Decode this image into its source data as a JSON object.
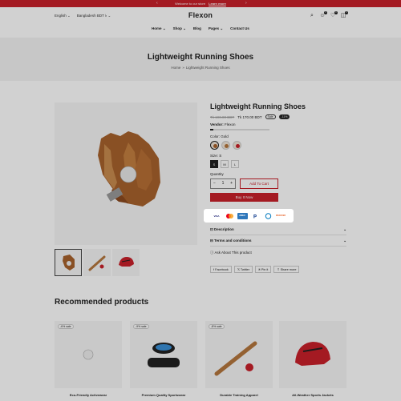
{
  "announcement": {
    "text": "Welcome to our store",
    "link": "Learn more"
  },
  "topbar": {
    "language": "English",
    "currency": "Bangladesh BDT ৳"
  },
  "header": {
    "logo": "Flexon",
    "counts": {
      "account": "0",
      "wishlist": "0",
      "cart": "0"
    }
  },
  "nav": {
    "items": [
      "Home",
      "Shop",
      "Blog",
      "Pages",
      "Contact Us"
    ]
  },
  "breadcrumb_section": {
    "title": "Lightweight Running Shoes",
    "home": "Home",
    "current": "Lightweight Running Shoes"
  },
  "product": {
    "title": "Lightweight Running Shoes",
    "price_old": "Tk 190.00 BDT",
    "price_new": "Tk 170.00 BDT",
    "sale_badge": "Sale",
    "discount_badge": "-11%",
    "vendor_label": "Vendor:",
    "vendor": "Flexon",
    "stock_fill": 0.05,
    "color_label": "Color:",
    "color_value": "Gold",
    "size_label": "Size:",
    "size_value": "S",
    "sizes": [
      "S",
      "M",
      "L"
    ],
    "quantity_label": "Quantity",
    "quantity": "1",
    "add_to_cart": "Add To Cart",
    "buy_now": "Buy It Now",
    "payments": [
      "VISA",
      "MC",
      "AMEX",
      "PayPal",
      "DC",
      "DISCOVER"
    ],
    "accordion": [
      "Description",
      "Terms and conditions"
    ],
    "ask": "Ask About This product",
    "share": [
      "Facebook",
      "Twitter",
      "Pin it",
      "Share more"
    ]
  },
  "recommended": {
    "title": "Recommended products",
    "items": [
      {
        "tag": "-6% sale",
        "title": "Eco-Friendly Activewear"
      },
      {
        "tag": "-9% sale",
        "title": "Premium Quality Sportswear"
      },
      {
        "tag": "-8% sale",
        "title": "Durable Training Apparel"
      },
      {
        "tag": "",
        "title": "All-Weather Sports Jackets"
      }
    ]
  },
  "colors": {
    "brand_red": "#c8202a",
    "dark": "#222222"
  }
}
